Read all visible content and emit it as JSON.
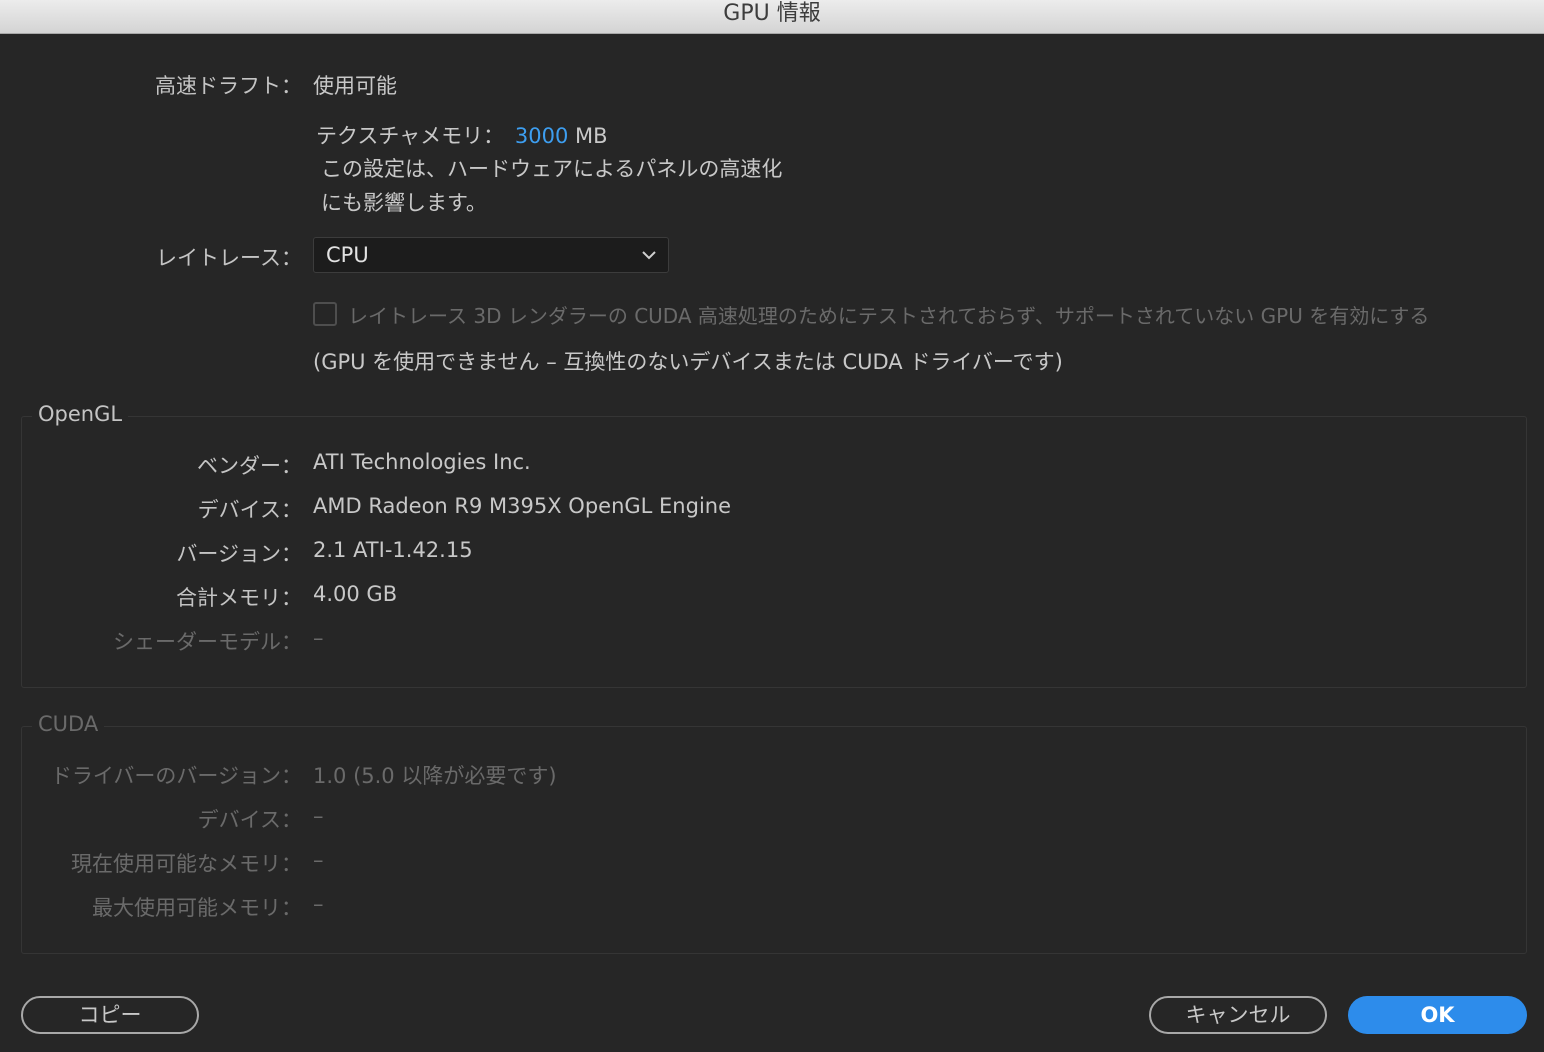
{
  "window": {
    "title": "GPU 情報"
  },
  "fast_draft": {
    "label": "高速ドラフト：",
    "value": "使用可能"
  },
  "texture_memory": {
    "label": "テクスチャメモリ：",
    "value": "3000",
    "unit": "MB",
    "note_line1": "この設定は、ハードウェアによるパネルの高速化",
    "note_line2": "にも影響します。"
  },
  "ray_trace": {
    "label": "レイトレース：",
    "selected": "CPU"
  },
  "checkbox": {
    "checked": false,
    "label": "レイトレース 3D レンダラーの CUDA 高速処理のためにテストされておらず、サポートされていない GPU を有効にする"
  },
  "gpu_status": "(GPU を使用できません – 互換性のないデバイスまたは CUDA ドライバーです)",
  "opengl": {
    "legend": "OpenGL",
    "rows": [
      {
        "label": "ベンダー：",
        "value": "ATI Technologies Inc."
      },
      {
        "label": "デバイス：",
        "value": "AMD Radeon R9 M395X OpenGL Engine"
      },
      {
        "label": "バージョン：",
        "value": "2.1 ATI-1.42.15"
      },
      {
        "label": "合計メモリ：",
        "value": "4.00 GB"
      },
      {
        "label": "シェーダーモデル：",
        "value": "–"
      }
    ]
  },
  "cuda": {
    "legend": "CUDA",
    "rows": [
      {
        "label": "ドライバーのバージョン：",
        "value": "1.0 (5.0 以降が必要です)"
      },
      {
        "label": "デバイス：",
        "value": "–"
      },
      {
        "label": "現在使用可能なメモリ：",
        "value": "–"
      },
      {
        "label": "最大使用可能メモリ：",
        "value": "–"
      }
    ]
  },
  "buttons": {
    "copy": "コピー",
    "cancel": "キャンセル",
    "ok": "OK"
  },
  "colors": {
    "accent": "#3d9ef0",
    "ok_button": "#2d8ceb",
    "background": "#262626"
  },
  "icons": {
    "dropdown": "chevron-down-icon"
  }
}
